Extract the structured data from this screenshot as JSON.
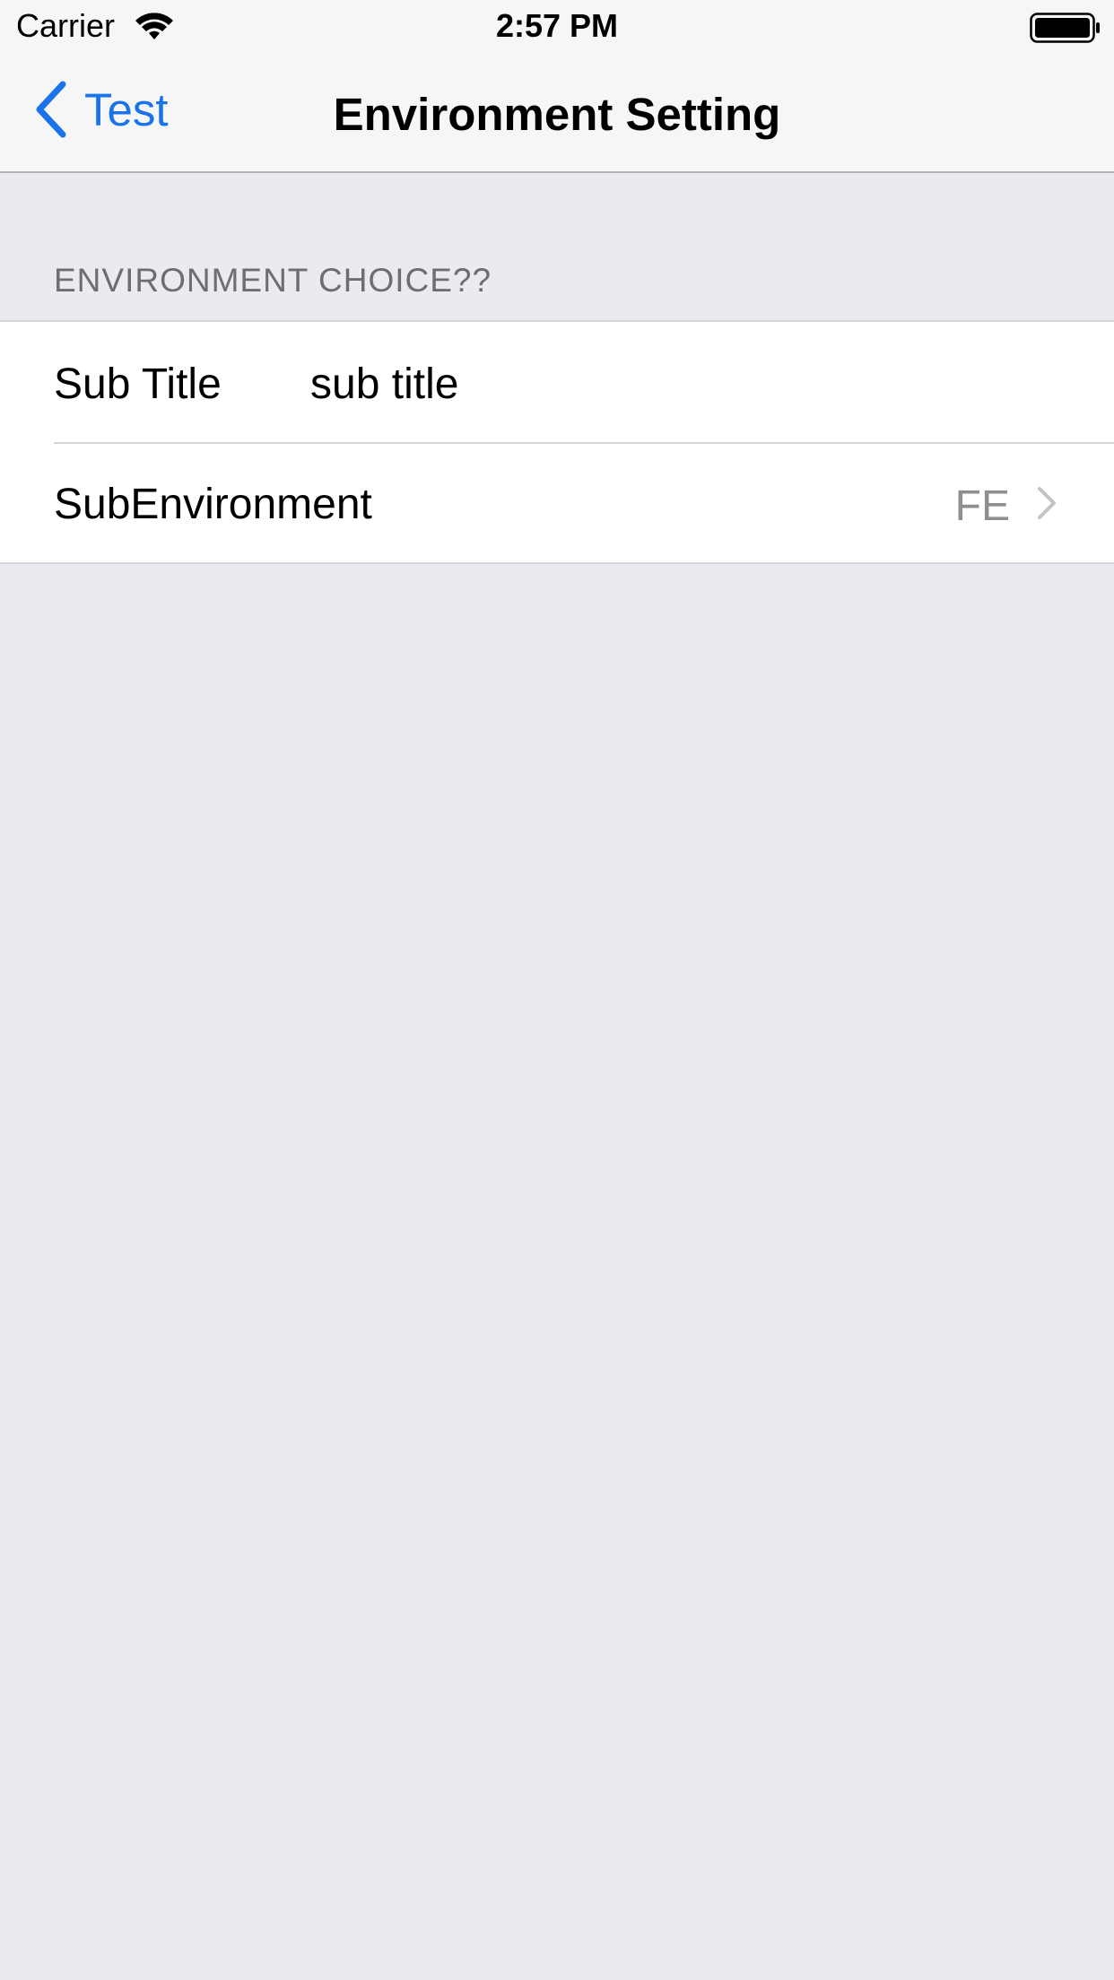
{
  "status_bar": {
    "carrier": "Carrier",
    "time": "2:57 PM",
    "wifi_icon": "wifi-icon",
    "battery_icon": "battery-icon"
  },
  "nav": {
    "back_label": "Test",
    "back_icon": "chevron-left-icon",
    "title": "Environment Setting"
  },
  "section": {
    "header": "ENVIRONMENT CHOICE??",
    "rows": [
      {
        "label": "Sub Title",
        "value": "sub title"
      },
      {
        "label": "SubEnvironment",
        "detail": "FE",
        "accessory": "chevron-right-icon"
      }
    ]
  },
  "colors": {
    "accent": "#1A73E8",
    "background": "#EBEAF0",
    "detail_text": "#8E8E93"
  }
}
